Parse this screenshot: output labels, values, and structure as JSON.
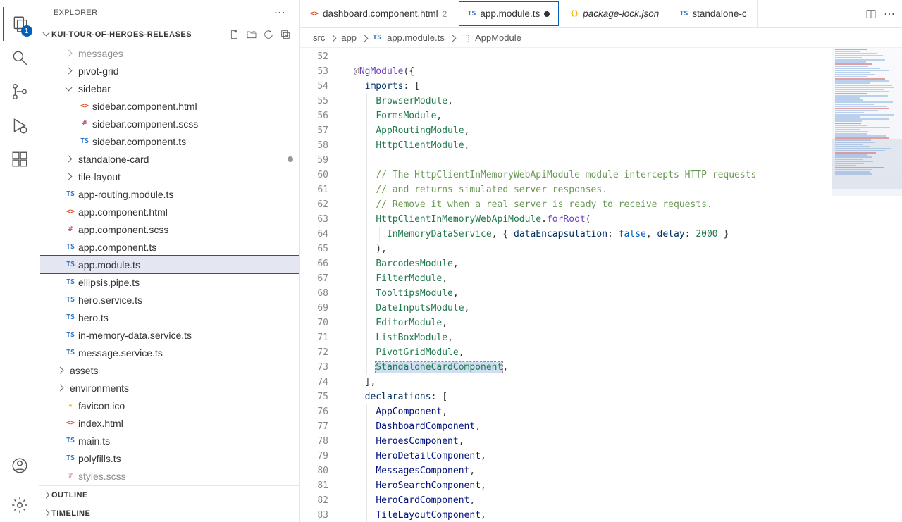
{
  "activityBar": {
    "explorerBadge": "1"
  },
  "sidebar": {
    "title": "EXPLORER",
    "workspace": "KUI-TOUR-OF-HEROES-RELEASES",
    "tree": [
      {
        "indent": 32,
        "chev": "right",
        "label": "messages",
        "dim": true
      },
      {
        "indent": 32,
        "chev": "right",
        "label": "pivot-grid"
      },
      {
        "indent": 32,
        "chev": "down",
        "label": "sidebar"
      },
      {
        "indent": 52,
        "icon": "html",
        "iconText": "<>",
        "label": "sidebar.component.html"
      },
      {
        "indent": 52,
        "icon": "scss",
        "iconText": "#",
        "label": "sidebar.component.scss"
      },
      {
        "indent": 52,
        "icon": "ts",
        "iconText": "TS",
        "label": "sidebar.component.ts"
      },
      {
        "indent": 32,
        "chev": "right",
        "label": "standalone-card",
        "dirty": true
      },
      {
        "indent": 32,
        "chev": "right",
        "label": "tile-layout"
      },
      {
        "indent": 32,
        "icon": "ts",
        "iconText": "TS",
        "label": "app-routing.module.ts"
      },
      {
        "indent": 32,
        "icon": "html",
        "iconText": "<>",
        "label": "app.component.html"
      },
      {
        "indent": 32,
        "icon": "scss",
        "iconText": "#",
        "label": "app.component.scss"
      },
      {
        "indent": 32,
        "icon": "ts",
        "iconText": "TS",
        "label": "app.component.ts"
      },
      {
        "indent": 32,
        "icon": "ts",
        "iconText": "TS",
        "label": "app.module.ts",
        "selected": true
      },
      {
        "indent": 32,
        "icon": "ts",
        "iconText": "TS",
        "label": "ellipsis.pipe.ts"
      },
      {
        "indent": 32,
        "icon": "ts",
        "iconText": "TS",
        "label": "hero.service.ts"
      },
      {
        "indent": 32,
        "icon": "ts",
        "iconText": "TS",
        "label": "hero.ts"
      },
      {
        "indent": 32,
        "icon": "ts",
        "iconText": "TS",
        "label": "in-memory-data.service.ts"
      },
      {
        "indent": 32,
        "icon": "ts",
        "iconText": "TS",
        "label": "message.service.ts"
      },
      {
        "indent": 20,
        "chev": "right",
        "label": "assets"
      },
      {
        "indent": 20,
        "chev": "right",
        "label": "environments"
      },
      {
        "indent": 32,
        "icon": "star",
        "iconText": "★",
        "label": "favicon.ico"
      },
      {
        "indent": 32,
        "icon": "html",
        "iconText": "<>",
        "label": "index.html"
      },
      {
        "indent": 32,
        "icon": "ts",
        "iconText": "TS",
        "label": "main.ts"
      },
      {
        "indent": 32,
        "icon": "ts",
        "iconText": "TS",
        "label": "polyfills.ts"
      },
      {
        "indent": 32,
        "icon": "scss",
        "iconText": "#",
        "label": "styles.scss",
        "dim": true
      }
    ],
    "outline": "OUTLINE",
    "timeline": "TIMELINE"
  },
  "tabs": [
    {
      "icon": "html",
      "iconText": "<>",
      "name": "dashboard.component.html",
      "badge": "2"
    },
    {
      "icon": "ts",
      "iconText": "TS",
      "name": "app.module.ts",
      "active": true,
      "dirty": true
    },
    {
      "icon": "json",
      "iconText": "{}",
      "name": "package-lock.json",
      "italic": true
    },
    {
      "icon": "ts",
      "iconText": "TS",
      "name": "standalone-c"
    }
  ],
  "breadcrumbs": {
    "p1": "src",
    "p2": "app",
    "p3": "app.module.ts",
    "p4": "AppModule"
  },
  "code": {
    "startLine": 52,
    "lines": [
      {
        "n": 52,
        "i": 0,
        "html": ""
      },
      {
        "n": 53,
        "i": 0,
        "html": "<span class='tok-decorator'>@</span><span class='tok-func'>NgModule</span>({"
      },
      {
        "n": 54,
        "i": 1,
        "html": "<span class='tok-key'>imports</span>: ["
      },
      {
        "n": 55,
        "i": 2,
        "html": "<span class='tok-type'>BrowserModule</span>,"
      },
      {
        "n": 56,
        "i": 2,
        "html": "<span class='tok-type'>FormsModule</span>,"
      },
      {
        "n": 57,
        "i": 2,
        "html": "<span class='tok-type'>AppRoutingModule</span>,"
      },
      {
        "n": 58,
        "i": 2,
        "html": "<span class='tok-type'>HttpClientModule</span>,"
      },
      {
        "n": 59,
        "i": 2,
        "html": ""
      },
      {
        "n": 60,
        "i": 2,
        "html": "<span class='tok-comment'>// The HttpClientInMemoryWebApiModule module intercepts HTTP requests</span>"
      },
      {
        "n": 61,
        "i": 2,
        "html": "<span class='tok-comment'>// and returns simulated server responses.</span>"
      },
      {
        "n": 62,
        "i": 2,
        "html": "<span class='tok-comment'>// Remove it when a real server is ready to receive requests.</span>"
      },
      {
        "n": 63,
        "i": 2,
        "html": "<span class='tok-type'>HttpClientInMemoryWebApiModule</span>.<span class='tok-method'>forRoot</span>("
      },
      {
        "n": 64,
        "i": 3,
        "html": "<span class='tok-type'>InMemoryDataService</span>, { <span class='tok-prop'>dataEncapsulation</span>: <span class='tok-bool'>false</span>, <span class='tok-prop'>delay</span>: <span class='tok-num'>2000</span> }"
      },
      {
        "n": 65,
        "i": 2,
        "html": "),",
        "marker": "red"
      },
      {
        "n": 66,
        "i": 2,
        "html": "<span class='tok-type'>BarcodesModule</span>,"
      },
      {
        "n": 67,
        "i": 2,
        "html": "<span class='tok-type'>FilterModule</span>,"
      },
      {
        "n": 68,
        "i": 2,
        "html": "<span class='tok-type'>TooltipsModule</span>,"
      },
      {
        "n": 69,
        "i": 2,
        "html": "<span class='tok-type'>DateInputsModule</span>,"
      },
      {
        "n": 70,
        "i": 2,
        "html": "<span class='tok-type'>EditorModule</span>,"
      },
      {
        "n": 71,
        "i": 2,
        "html": "<span class='tok-type'>ListBoxModule</span>,"
      },
      {
        "n": 72,
        "i": 2,
        "html": "<span class='tok-type'>PivotGridModule</span>,"
      },
      {
        "n": 73,
        "i": 2,
        "html": "<span class='tok-type tok-hl'>StandaloneCardComponent</span>,",
        "marker": "bulb"
      },
      {
        "n": 74,
        "i": 1,
        "html": "],"
      },
      {
        "n": 75,
        "i": 1,
        "html": "<span class='tok-key'>declarations</span>: ["
      },
      {
        "n": 76,
        "i": 2,
        "html": "<span class='tok-var'>AppComponent</span>,"
      },
      {
        "n": 77,
        "i": 2,
        "html": "<span class='tok-var'>DashboardComponent</span>,"
      },
      {
        "n": 78,
        "i": 2,
        "html": "<span class='tok-var'>HeroesComponent</span>,"
      },
      {
        "n": 79,
        "i": 2,
        "html": "<span class='tok-var'>HeroDetailComponent</span>,"
      },
      {
        "n": 80,
        "i": 2,
        "html": "<span class='tok-var'>MessagesComponent</span>,"
      },
      {
        "n": 81,
        "i": 2,
        "html": "<span class='tok-var'>HeroSearchComponent</span>,"
      },
      {
        "n": 82,
        "i": 2,
        "html": "<span class='tok-var'>HeroCardComponent</span>,"
      },
      {
        "n": 83,
        "i": 2,
        "html": "<span class='tok-var'>TileLayoutComponent</span>,"
      }
    ]
  }
}
